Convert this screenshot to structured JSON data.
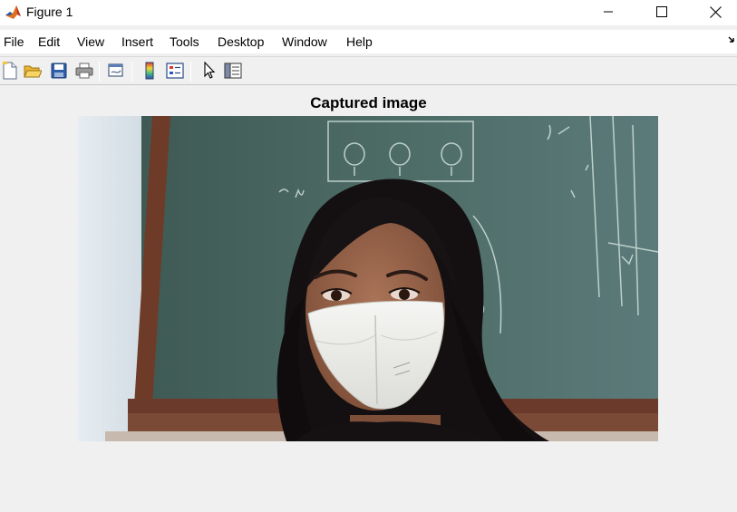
{
  "window": {
    "title": "Figure 1",
    "controls": [
      "minimize",
      "maximize",
      "close"
    ]
  },
  "menu": {
    "items": [
      "File",
      "Edit",
      "View",
      "Insert",
      "Tools",
      "Desktop",
      "Window",
      "Help"
    ]
  },
  "toolbar": {
    "buttons": [
      "new-figure-icon",
      "open-file-icon",
      "save-icon",
      "print-icon",
      "link-plot-icon",
      "insert-colorbar-icon",
      "insert-legend-icon",
      "edit-plot-pointer-icon",
      "property-inspector-icon"
    ]
  },
  "axes": {
    "title": "Captured image"
  },
  "photo": {
    "content": "webcam photograph",
    "chalkboard_color": "#4d6b64",
    "frame_color": "#6b3b2a",
    "wall_color": "#dde4ea",
    "mask_color": "#f2f2f0"
  }
}
